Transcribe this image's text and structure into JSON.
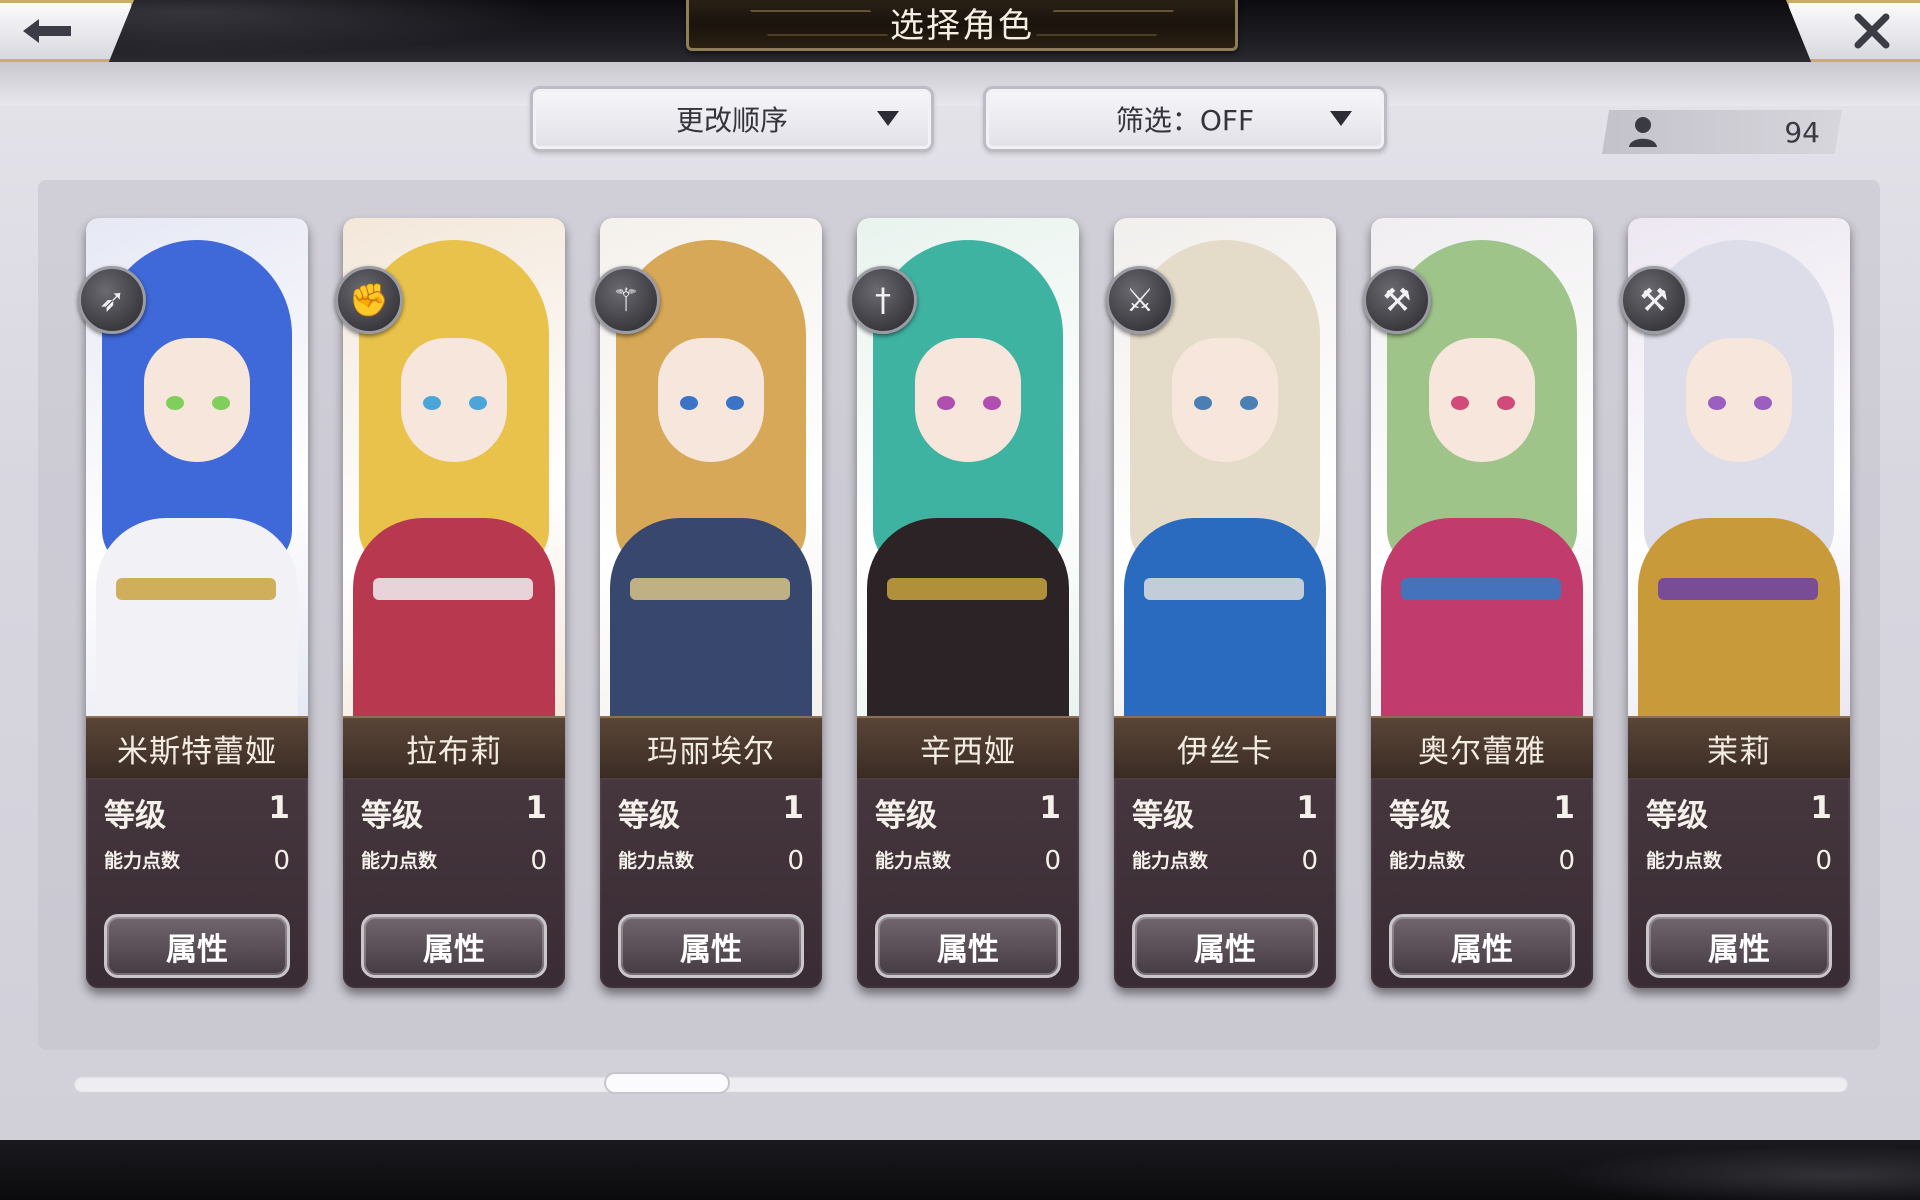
{
  "header": {
    "title": "选择角色",
    "back_icon": "←",
    "close_icon": "✕"
  },
  "toolbar": {
    "sort_label": "更改顺序",
    "filter_label": "筛选：OFF"
  },
  "character_count": "94",
  "stat_labels": {
    "level": "等级",
    "ability_points": "能力点数",
    "attribute_button": "属性"
  },
  "characters": [
    {
      "name": "米斯特蕾娅",
      "level": "1",
      "ability_points": "0",
      "weapon": "bow-icon",
      "weapon_glyph": "➶",
      "hair": "#3f68d8",
      "outfit": "#f2f2f6",
      "eyes": "#7fcf5a",
      "bg": "#e6e8f4",
      "accent": "#c9a341"
    },
    {
      "name": "拉布莉",
      "level": "1",
      "ability_points": "0",
      "weapon": "gauntlet-icon",
      "weapon_glyph": "✊",
      "hair": "#e8c24b",
      "outfit": "#b8394f",
      "eyes": "#4aa6d8",
      "bg": "#f3e7d9",
      "accent": "#f0f0f0"
    },
    {
      "name": "玛丽埃尔",
      "level": "1",
      "ability_points": "0",
      "weapon": "staff-icon",
      "weapon_glyph": "⚚",
      "hair": "#d6a857",
      "outfit": "#38476e",
      "eyes": "#3b74c7",
      "bg": "#f4f1ec",
      "accent": "#d8c48a"
    },
    {
      "name": "辛西娅",
      "level": "1",
      "ability_points": "0",
      "weapon": "sword-icon",
      "weapon_glyph": "†",
      "hair": "#3fb3a2",
      "outfit": "#2b2326",
      "eyes": "#b04fb0",
      "bg": "#e9f3ee",
      "accent": "#c9a341"
    },
    {
      "name": "伊丝卡",
      "level": "1",
      "ability_points": "0",
      "weapon": "blade-icon",
      "weapon_glyph": "⚔",
      "hair": "#e4dcc8",
      "outfit": "#2a6bbf",
      "eyes": "#4a7fb5",
      "bg": "#f1efec",
      "accent": "#dedede"
    },
    {
      "name": "奥尔蕾雅",
      "level": "1",
      "ability_points": "0",
      "weapon": "axe-icon",
      "weapon_glyph": "⚒",
      "hair": "#9fc48a",
      "outfit": "#c23b6d",
      "eyes": "#d04a7a",
      "bg": "#f0eef0",
      "accent": "#2e7ec9"
    },
    {
      "name": "茉莉",
      "level": "1",
      "ability_points": "0",
      "weapon": "axe-icon",
      "weapon_glyph": "⚒",
      "hair": "#dcdde8",
      "outfit": "#c99a3a",
      "eyes": "#9a5fc0",
      "bg": "#ece7f1",
      "accent": "#6b3fa6"
    }
  ]
}
